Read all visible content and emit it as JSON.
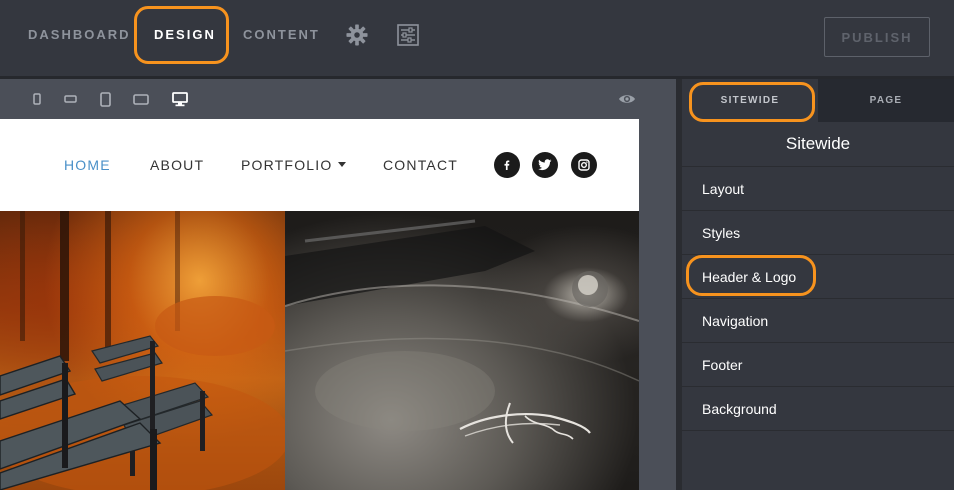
{
  "topnav": {
    "dashboard": "DASHBOARD",
    "design": "DESIGN",
    "content": "CONTENT",
    "settings_icon": "gear-icon",
    "layout_icon": "sliders-icon",
    "publish": "PUBLISH"
  },
  "preview": {
    "devices": [
      "phone-portrait-icon",
      "phone-landscape-icon",
      "tablet-portrait-icon",
      "tablet-landscape-icon",
      "desktop-icon"
    ],
    "active_device": "desktop-icon",
    "preview_icon": "eye-icon"
  },
  "site": {
    "nav": [
      "HOME",
      "ABOUT",
      "PORTFOLIO",
      "CONTACT"
    ],
    "active_nav": "HOME",
    "social": [
      "facebook-icon",
      "twitter-icon",
      "instagram-icon"
    ],
    "photos": [
      "autumn-park-benches",
      "vintage-plymouth-car"
    ]
  },
  "panel": {
    "tabs": [
      "SITEWIDE",
      "PAGE"
    ],
    "active_tab": "SITEWIDE",
    "title": "Sitewide",
    "items": [
      "Layout",
      "Styles",
      "Header & Logo",
      "Navigation",
      "Footer",
      "Background"
    ]
  },
  "colors": {
    "highlight": "#f7931e",
    "nav_active": "#4a90c8",
    "topbar": "#34373f"
  }
}
